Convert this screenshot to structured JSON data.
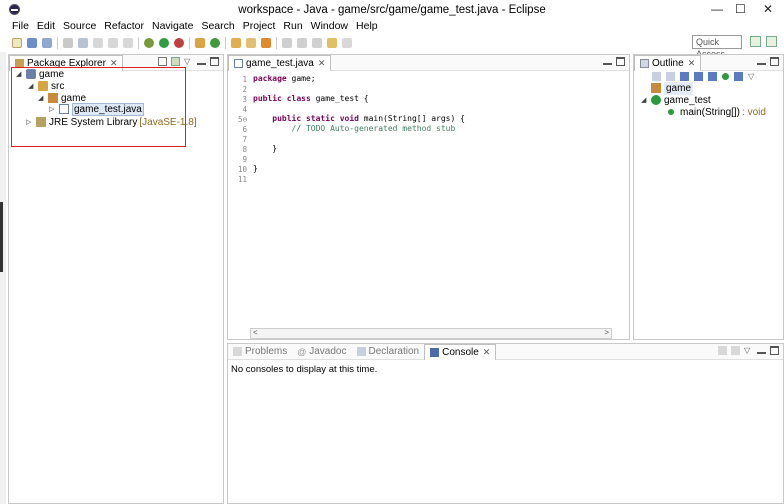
{
  "window": {
    "title": "workspace - Java - game/src/game/game_test.java - Eclipse",
    "minimize": "—",
    "maximize": "☐",
    "close": "✕"
  },
  "menu": [
    "File",
    "Edit",
    "Source",
    "Refactor",
    "Navigate",
    "Search",
    "Project",
    "Run",
    "Window",
    "Help"
  ],
  "toolbar": {
    "quick_access": "Quick Access"
  },
  "package_explorer": {
    "tab_label": "Package Explorer",
    "tree": [
      {
        "label": "game",
        "icon": "project-icon"
      },
      {
        "label": "src",
        "icon": "source-folder-icon"
      },
      {
        "label": "game",
        "icon": "package-icon"
      },
      {
        "label": "game_test.java",
        "icon": "java-file-icon"
      },
      {
        "label": "JRE System Library",
        "suffix": "[JavaSE-1.8]",
        "icon": "library-icon"
      }
    ]
  },
  "editor": {
    "tab_label": "game_test.java",
    "lines": [
      {
        "n": "1",
        "parts": [
          {
            "t": "package",
            "k": "kw"
          },
          {
            "t": " game;",
            "k": ""
          }
        ]
      },
      {
        "n": "2",
        "parts": []
      },
      {
        "n": "3",
        "parts": [
          {
            "t": "public class",
            "k": "kw"
          },
          {
            "t": " game_test {",
            "k": ""
          }
        ]
      },
      {
        "n": "4",
        "parts": []
      },
      {
        "n": "5⊖",
        "parts": [
          {
            "t": "    ",
            "k": ""
          },
          {
            "t": "public static void",
            "k": "kw"
          },
          {
            "t": " main(String[] args) {",
            "k": ""
          }
        ]
      },
      {
        "n": "6",
        "parts": [
          {
            "t": "        // TODO Auto-generated method stub",
            "k": "cm"
          }
        ]
      },
      {
        "n": "7",
        "parts": []
      },
      {
        "n": "8",
        "parts": [
          {
            "t": "    }",
            "k": ""
          }
        ]
      },
      {
        "n": "9",
        "parts": []
      },
      {
        "n": "10",
        "parts": [
          {
            "t": "}",
            "k": ""
          }
        ]
      },
      {
        "n": "11",
        "parts": []
      }
    ]
  },
  "outline": {
    "tab_label": "Outline",
    "items": [
      {
        "label": "game",
        "icon": "package-icon"
      },
      {
        "label": "game_test",
        "icon": "class-icon"
      },
      {
        "label": "main(String[])",
        "suffix": ": void",
        "icon": "method-icon"
      }
    ]
  },
  "bottom": {
    "tabs": [
      "Problems",
      "Javadoc",
      "Declaration",
      "Console"
    ],
    "active": "Console",
    "message": "No consoles to display at this time."
  },
  "colors": {
    "keyword": "#7f0055",
    "comment": "#3f7f5f",
    "highlight_box": "#e02020",
    "library_version": "#8b6a20"
  }
}
